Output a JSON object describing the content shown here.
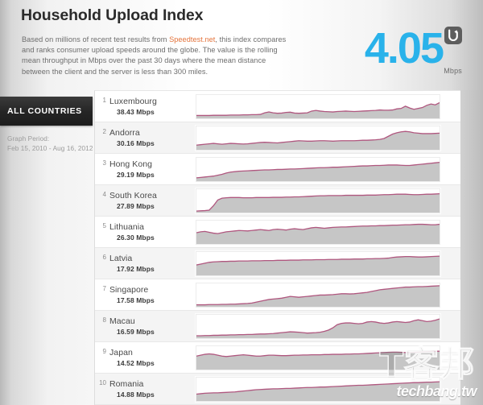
{
  "header": {
    "title": "Household Upload Index",
    "description_before_link": "Based on millions of recent test results from ",
    "link_text": "Speedtest.net",
    "description_after_link": ", this index compares and ranks consumer upload speeds around the globe. The value is the rolling mean throughput in Mbps over the past 30 days where the mean distance between the client and the server is less than 300 miles.",
    "index_value": "4.05",
    "index_unit": "Mbps",
    "badge_icon": "upload-badge-icon",
    "accent_color": "#29b2ea",
    "link_color": "#e4733b"
  },
  "sidebar": {
    "tab_label": "ALL COUNTRIES",
    "graph_period_label": "Graph Period:",
    "graph_period_value": "Feb 15, 2010 - Aug 16, 2012"
  },
  "watermark": {
    "cjk": "T客邦",
    "url": "techbang.tw"
  },
  "chart_data": {
    "type": "area",
    "title": "Household Upload Index",
    "ylabel": "Mbps",
    "xlabel": "Feb 15, 2010 - Aug 16, 2012",
    "grid": false,
    "legend": "none",
    "line_color": "#b0577f",
    "fill_color": "#c6c6c6",
    "series": [
      {
        "rank": "1",
        "name": "Luxembourg",
        "value": "38.43 Mbps",
        "numeric_value": 38.43,
        "sparkline": [
          10,
          10,
          10,
          10,
          11,
          11,
          11,
          11,
          12,
          12,
          12,
          13,
          13,
          14,
          14,
          15,
          22,
          26,
          22,
          20,
          21,
          24,
          25,
          21,
          20,
          21,
          22,
          30,
          33,
          30,
          28,
          27,
          26,
          28,
          29,
          30,
          29,
          28,
          29,
          30,
          31,
          32,
          33,
          35,
          34,
          34,
          35,
          40,
          42,
          52,
          44,
          38,
          42,
          46,
          56,
          62,
          58,
          68
        ]
      },
      {
        "rank": "2",
        "name": "Andorra",
        "value": "30.16 Mbps",
        "numeric_value": 30.16,
        "sparkline": [
          18,
          20,
          22,
          24,
          26,
          24,
          22,
          24,
          26,
          25,
          24,
          23,
          24,
          26,
          28,
          30,
          31,
          30,
          29,
          28,
          30,
          32,
          34,
          36,
          38,
          37,
          36,
          36,
          37,
          38,
          38,
          37,
          36,
          37,
          38,
          38,
          38,
          38,
          39,
          40,
          40,
          41,
          42,
          44,
          48,
          58,
          68,
          74,
          78,
          80,
          78,
          74,
          72,
          70,
          70,
          70,
          71,
          72
        ]
      },
      {
        "rank": "3",
        "name": "Hong Kong",
        "value": "29.19 Mbps",
        "numeric_value": 29.19,
        "sparkline": [
          12,
          14,
          16,
          18,
          20,
          24,
          28,
          34,
          38,
          40,
          42,
          43,
          44,
          45,
          46,
          47,
          48,
          48,
          49,
          50,
          50,
          51,
          52,
          52,
          53,
          54,
          55,
          56,
          57,
          58,
          58,
          59,
          60,
          60,
          61,
          62,
          63,
          64,
          65,
          66,
          66,
          67,
          68,
          68,
          69,
          70,
          70,
          70,
          69,
          68,
          68,
          70,
          72,
          74,
          76,
          78,
          80,
          82
        ]
      },
      {
        "rank": "4",
        "name": "South Korea",
        "value": "27.89 Mbps",
        "numeric_value": 27.89,
        "sparkline": [
          4,
          5,
          6,
          8,
          28,
          54,
          62,
          64,
          65,
          65,
          65,
          64,
          64,
          64,
          65,
          65,
          65,
          65,
          66,
          66,
          66,
          67,
          67,
          68,
          68,
          69,
          70,
          71,
          72,
          73,
          73,
          74,
          74,
          74,
          74,
          75,
          75,
          75,
          75,
          75,
          76,
          76,
          76,
          77,
          78,
          78,
          79,
          80,
          80,
          80,
          79,
          78,
          78,
          79,
          80,
          80,
          81,
          82
        ]
      },
      {
        "rank": "5",
        "name": "Lithuania",
        "value": "26.30 Mbps",
        "numeric_value": 26.3,
        "sparkline": [
          48,
          52,
          54,
          50,
          46,
          44,
          48,
          52,
          54,
          56,
          58,
          57,
          56,
          58,
          60,
          62,
          60,
          58,
          62,
          64,
          62,
          60,
          64,
          66,
          64,
          62,
          66,
          70,
          72,
          70,
          68,
          70,
          72,
          73,
          74,
          74,
          75,
          76,
          77,
          78,
          78,
          79,
          79,
          80,
          80,
          81,
          82,
          82,
          83,
          84,
          84,
          85,
          86,
          86,
          85,
          84,
          84,
          86
        ]
      },
      {
        "rank": "6",
        "name": "Latvia",
        "value": "17.92 Mbps",
        "numeric_value": 17.92,
        "sparkline": [
          44,
          48,
          52,
          56,
          58,
          59,
          60,
          60,
          61,
          61,
          62,
          62,
          62,
          63,
          63,
          63,
          64,
          64,
          64,
          65,
          65,
          65,
          66,
          66,
          66,
          67,
          67,
          67,
          68,
          68,
          68,
          69,
          69,
          69,
          70,
          70,
          70,
          71,
          71,
          71,
          72,
          72,
          73,
          73,
          74,
          75,
          78,
          80,
          81,
          82,
          82,
          81,
          80,
          80,
          81,
          82,
          83,
          84
        ]
      },
      {
        "rank": "7",
        "name": "Singapore",
        "value": "17.58 Mbps",
        "numeric_value": 17.58,
        "sparkline": [
          6,
          6,
          6,
          7,
          7,
          7,
          8,
          8,
          9,
          9,
          10,
          11,
          12,
          14,
          18,
          22,
          26,
          30,
          32,
          34,
          36,
          40,
          44,
          42,
          40,
          42,
          44,
          46,
          48,
          50,
          50,
          51,
          52,
          54,
          56,
          56,
          55,
          56,
          58,
          60,
          62,
          66,
          70,
          74,
          76,
          78,
          80,
          82,
          84,
          86,
          86,
          87,
          88,
          88,
          89,
          90,
          91,
          92
        ]
      },
      {
        "rank": "8",
        "name": "Macau",
        "value": "16.59 Mbps",
        "numeric_value": 16.59,
        "sparkline": [
          8,
          8,
          9,
          9,
          10,
          10,
          11,
          11,
          12,
          12,
          13,
          13,
          14,
          14,
          15,
          16,
          16,
          17,
          18,
          20,
          22,
          24,
          26,
          25,
          24,
          22,
          20,
          21,
          22,
          24,
          28,
          34,
          44,
          58,
          64,
          66,
          66,
          64,
          62,
          64,
          70,
          72,
          70,
          66,
          64,
          66,
          70,
          72,
          70,
          68,
          70,
          76,
          80,
          76,
          72,
          74,
          78,
          84
        ]
      },
      {
        "rank": "9",
        "name": "Japan",
        "value": "14.52 Mbps",
        "numeric_value": 14.52,
        "sparkline": [
          58,
          62,
          66,
          68,
          66,
          62,
          58,
          56,
          58,
          60,
          62,
          64,
          62,
          60,
          58,
          58,
          60,
          62,
          62,
          61,
          60,
          60,
          61,
          62,
          62,
          63,
          63,
          64,
          64,
          64,
          65,
          65,
          66,
          66,
          66,
          67,
          67,
          68,
          68,
          69,
          70,
          71,
          72,
          73,
          74,
          75,
          76,
          76,
          75,
          74,
          74,
          75,
          76,
          77,
          78,
          79,
          80,
          80
        ]
      },
      {
        "rank": "10",
        "name": "Romania",
        "value": "14.88 Mbps",
        "numeric_value": 14.88,
        "sparkline": [
          28,
          30,
          32,
          33,
          34,
          34,
          35,
          36,
          37,
          38,
          40,
          42,
          44,
          46,
          48,
          49,
          50,
          51,
          52,
          52,
          53,
          54,
          54,
          55,
          56,
          57,
          58,
          58,
          59,
          60,
          60,
          61,
          62,
          63,
          64,
          65,
          66,
          67,
          68,
          68,
          69,
          70,
          71,
          72,
          73,
          74,
          75,
          76,
          77,
          78,
          79,
          80,
          80,
          81,
          82,
          82,
          83,
          84
        ]
      }
    ]
  }
}
